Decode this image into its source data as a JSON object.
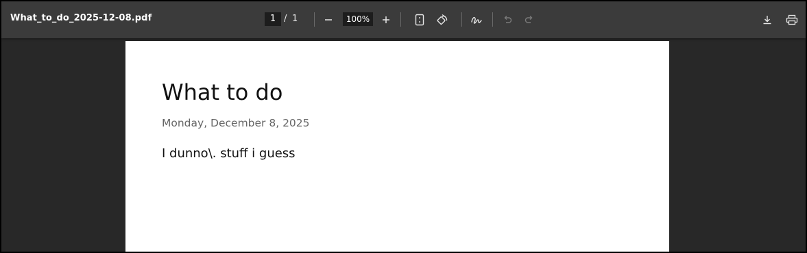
{
  "toolbar": {
    "file_name": "What_to_do_2025-12-08.pdf",
    "page_current": "1",
    "page_separator": "/",
    "page_total": "1",
    "zoom_level": "100%",
    "icons": {
      "zoom_out": "minus-icon",
      "zoom_in": "plus-icon",
      "fit_page": "fit-page-icon",
      "rotate": "rotate-icon",
      "draw": "draw-icon",
      "undo": "undo-icon",
      "redo": "redo-icon",
      "download": "download-icon",
      "print": "print-icon"
    }
  },
  "document": {
    "title": "What to do",
    "date": "Monday, December 8, 2025",
    "body": "I dunno\\. stuff i guess"
  },
  "colors": {
    "toolbar_bg": "#3b3b3b",
    "viewer_bg": "#282828",
    "page_bg": "#ffffff",
    "disabled_icon": "#7a7a7a"
  }
}
